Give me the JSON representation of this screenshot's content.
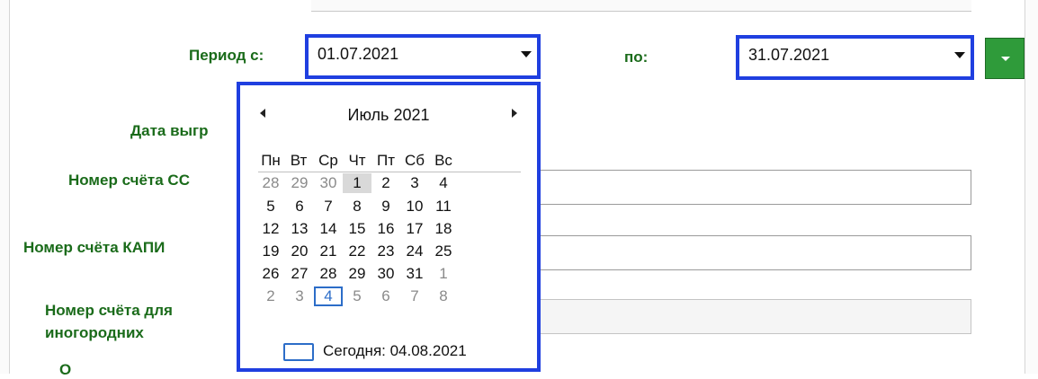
{
  "form": {
    "period_from_label": "Период с:",
    "period_from_value": "01.07.2021",
    "period_to_label": "по:",
    "period_to_value": "31.07.2021",
    "labels": [
      "Дата выгр",
      "Номер счёта СС",
      "Номер счёта КАПИ",
      "Номер счёта для",
      "иногородних",
      "О"
    ]
  },
  "calendar": {
    "month_title": "Июль 2021",
    "weekdays": [
      "Пн",
      "Вт",
      "Ср",
      "Чт",
      "Пт",
      "Сб",
      "Вс"
    ],
    "weeks": [
      [
        "28",
        "29",
        "30",
        "1",
        "2",
        "3",
        "4"
      ],
      [
        "5",
        "6",
        "7",
        "8",
        "9",
        "10",
        "11"
      ],
      [
        "12",
        "13",
        "14",
        "15",
        "16",
        "17",
        "18"
      ],
      [
        "19",
        "20",
        "21",
        "22",
        "23",
        "24",
        "25"
      ],
      [
        "26",
        "27",
        "28",
        "29",
        "30",
        "31",
        "1"
      ],
      [
        "2",
        "3",
        "4",
        "5",
        "6",
        "7",
        "8"
      ]
    ],
    "today_label": "Сегодня: 04.08.2021"
  },
  "colors": {
    "label_green": "#1a6b1a",
    "highlight_border": "#1f3fe0",
    "green_button": "#2f9b3a",
    "today_border": "#2c6dc8"
  }
}
